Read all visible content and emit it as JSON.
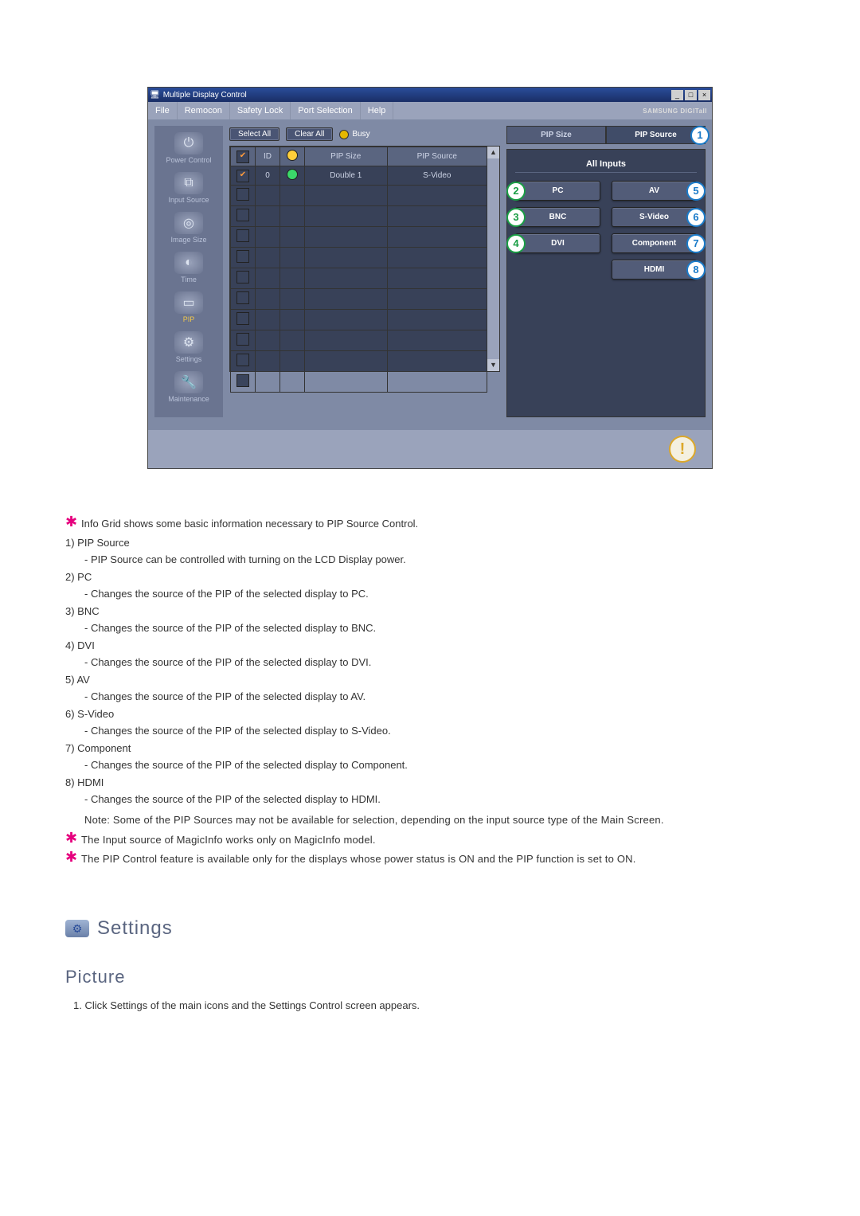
{
  "window": {
    "title": "Multiple Display Control",
    "min": "_",
    "max": "□",
    "close": "×"
  },
  "menu": {
    "file": "File",
    "remocon": "Remocon",
    "safety": "Safety Lock",
    "port": "Port Selection",
    "help": "Help",
    "brand": "SAMSUNG DIGITall"
  },
  "sidebar": {
    "power": "Power Control",
    "input": "Input Source",
    "image": "Image Size",
    "time": "Time",
    "pip": "PIP",
    "settings": "Settings",
    "maintenance": "Maintenance"
  },
  "toolbar": {
    "select_all": "Select All",
    "clear_all": "Clear All",
    "busy": "Busy"
  },
  "grid": {
    "headers": {
      "chk": "✔",
      "id": "ID",
      "status": "●",
      "size": "PIP Size",
      "source": "PIP Source"
    },
    "row0": {
      "id": "0",
      "size": "Double 1",
      "source": "S-Video"
    }
  },
  "right": {
    "tab_size": "PIP Size",
    "tab_source": "PIP Source",
    "badge1": "1",
    "section": "All Inputs",
    "pc": "PC",
    "b2": "2",
    "bnc": "BNC",
    "b3": "3",
    "dvi": "DVI",
    "b4": "4",
    "av": "AV",
    "b5": "5",
    "svideo": "S-Video",
    "b6": "6",
    "component": "Component",
    "b7": "7",
    "hdmi": "HDMI",
    "b8": "8"
  },
  "info_icon": "!",
  "doc": {
    "intro": "Info Grid shows some basic information necessary to PIP Source Control.",
    "i1_t": "1)  PIP Source",
    "i1_d": "- PIP Source can be controlled with turning on the LCD Display power.",
    "i2_t": "2)  PC",
    "i2_d": "- Changes the source of the PIP of the selected display to PC.",
    "i3_t": "3)  BNC",
    "i3_d": "- Changes the source of the PIP of the selected display to BNC.",
    "i4_t": "4)  DVI",
    "i4_d": "- Changes the source of the PIP of the selected display to DVI.",
    "i5_t": "5)  AV",
    "i5_d": "- Changes the source of the PIP of the selected display to AV.",
    "i6_t": "6)  S-Video",
    "i6_d": "- Changes the source of the PIP of the selected display to S-Video.",
    "i7_t": "7)  Component",
    "i7_d": "- Changes the source of the PIP of the selected display to Component.",
    "i8_t": "8)  HDMI",
    "i8_d": "- Changes the source of the PIP of the selected display to HDMI.",
    "note": "Note: Some of the PIP Sources may not be available for selection, depending on the input source type of the Main Screen.",
    "star2": "The Input source of MagicInfo works only on MagicInfo model.",
    "star3": "The PIP Control feature is available only for the displays whose power status is ON and the PIP function is set to ON.",
    "settings": "Settings",
    "picture": "Picture",
    "picture_step": "1.  Click Settings of the main icons and the Settings Control screen appears."
  }
}
